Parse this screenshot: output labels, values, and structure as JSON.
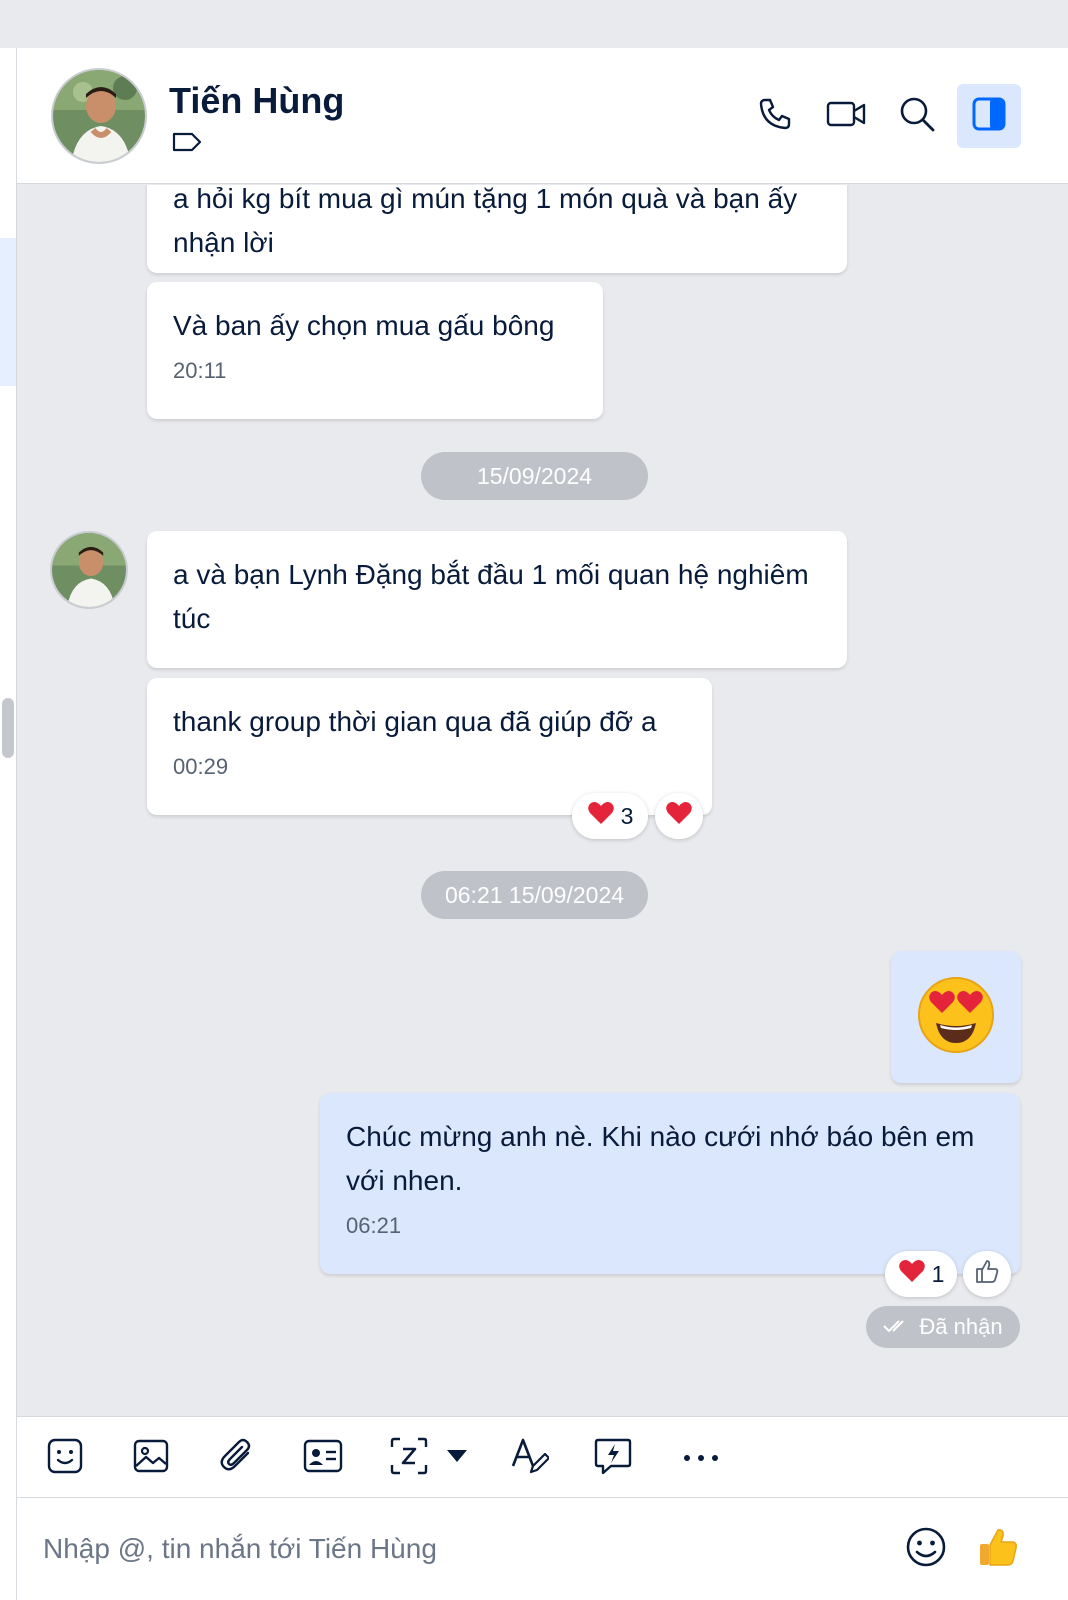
{
  "header": {
    "contact_name": "Tiến Hùng"
  },
  "messages": [
    {
      "text": "a hỏi kg bít mua gì mún tặng 1 món quà và bạn ấy nhận lời"
    },
    {
      "text": "Và ban ấy chọn mua gấu bông",
      "time": "20:11"
    },
    {
      "date": "15/09/2024"
    },
    {
      "text": "a và bạn Lynh Đặng bắt đầu 1 mối quan hệ nghiêm túc"
    },
    {
      "text": "thank group thời gian qua đã giúp đỡ a",
      "time": "00:29",
      "reaction_count": "3"
    },
    {
      "date": "06:21 15/09/2024"
    },
    {
      "emoji": "heart-eyes"
    },
    {
      "text": "Chúc mừng anh nè. Khi nào cưới nhớ báo bên em với nhen.",
      "time": "06:21",
      "reaction_count": "1",
      "status": "Đã nhận"
    }
  ],
  "composer": {
    "placeholder": "Nhập @, tin nhắn tới Tiến Hùng"
  },
  "icons": {
    "header": [
      "phone-icon",
      "video-call-icon",
      "search-icon",
      "sidebar-toggle-icon"
    ],
    "toolbar": [
      "sticker-icon",
      "image-icon",
      "attachment-icon",
      "contact-card-icon",
      "screenshot-icon",
      "dropdown-caret-icon",
      "text-format-icon",
      "quick-message-icon",
      "more-icon"
    ],
    "composer": [
      "emoji-icon",
      "thumbs-up-icon"
    ]
  },
  "colors": {
    "accent": "#0068ff",
    "chat_background": "#e9eaee",
    "mine_bubble": "#dbe7fd",
    "pill": "#bfc2c8",
    "heart": "#e3243b"
  }
}
